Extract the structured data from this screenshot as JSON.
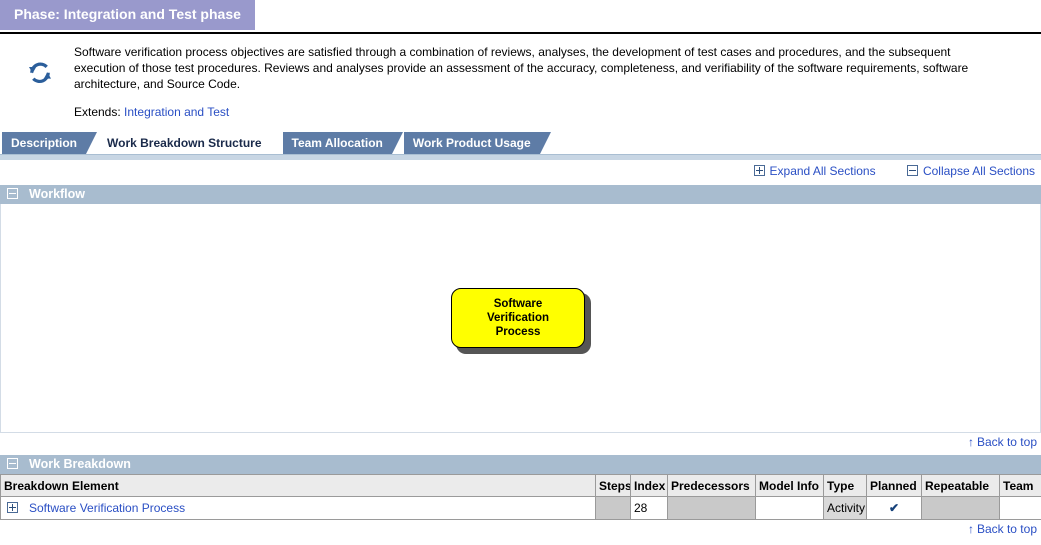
{
  "page": {
    "title": "Phase: Integration and Test phase"
  },
  "description": {
    "icon": "refresh-cycle-icon",
    "paragraph": "Software verification process objectives are satisfied through a combination of reviews, analyses, the development of test cases and procedures, and the subsequent execution of those test procedures. Reviews and analyses provide an assessment of the accuracy, completeness, and verifiability of the software requirements, software architecture, and Source Code.",
    "extends_label": "Extends:",
    "extends_link": "Integration and Test"
  },
  "tabs": [
    {
      "label": "Description",
      "active": false
    },
    {
      "label": "Work Breakdown Structure",
      "active": true
    },
    {
      "label": "Team Allocation",
      "active": false
    },
    {
      "label": "Work Product Usage",
      "active": false
    }
  ],
  "toolbar": {
    "expand_all": "Expand All Sections",
    "collapse_all": "Collapse All Sections",
    "expand_icon": "plus-box-icon",
    "collapse_icon": "minus-box-icon"
  },
  "workflow_section": {
    "title": "Workflow",
    "toggle_icon": "minus-box-icon",
    "node": {
      "label_line1": "Software",
      "label_line2": "Verification",
      "label_line3": "Process",
      "fill_color": "#ffff00",
      "border_color": "#000000"
    },
    "back_to_top": "Back to top",
    "back_to_top_icon": "up-arrow-icon"
  },
  "work_breakdown_section": {
    "title": "Work Breakdown",
    "toggle_icon": "minus-box-icon",
    "columns": [
      "Breakdown Element",
      "Steps",
      "Index",
      "Predecessors",
      "Model Info",
      "Type",
      "Planned",
      "Repeatable",
      "Team"
    ],
    "rows": [
      {
        "expand_icon": "plus-box-icon",
        "element": "Software Verification Process",
        "steps": "",
        "index": "28",
        "predecessors": "",
        "model_info": "",
        "type": "Activity",
        "planned": "✔",
        "repeatable": "",
        "team": ""
      }
    ],
    "back_to_top": "Back to top",
    "back_to_top_icon": "up-arrow-icon"
  },
  "colors": {
    "title_bar": "#9999cc",
    "tab_inactive": "#5e7ca6",
    "section_bar": "#a8bccf",
    "link": "#2a4fc4",
    "node_fill": "#ffff00"
  }
}
